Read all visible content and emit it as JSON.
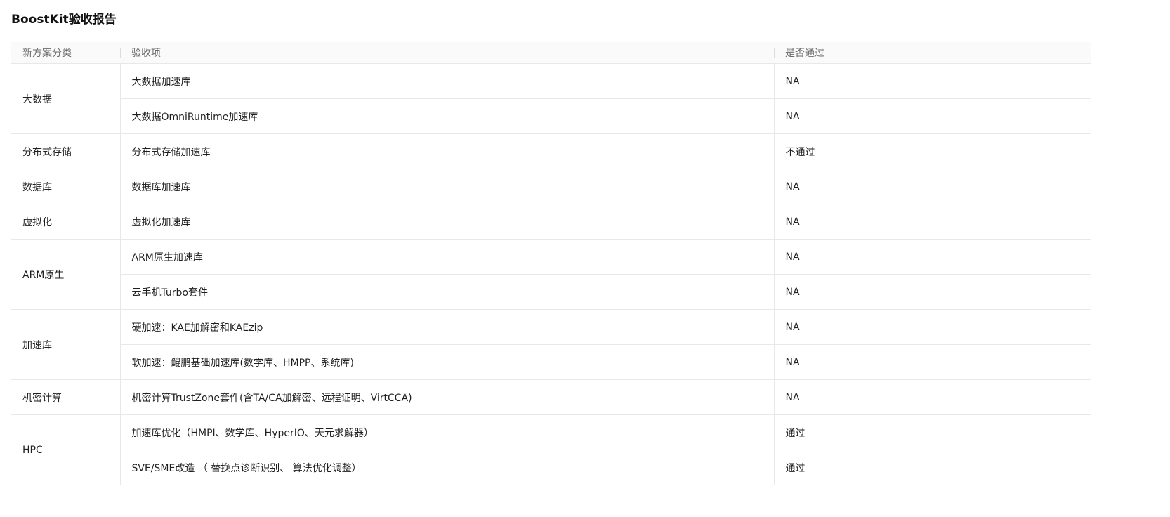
{
  "title": "BoostKit验收报告",
  "table": {
    "headers": [
      "新方案分类",
      "验收项",
      "是否通过"
    ],
    "groups": [
      {
        "category": "大数据",
        "items": [
          {
            "name": "大数据加速库",
            "result": "NA"
          },
          {
            "name": "大数据OmniRuntime加速库",
            "result": "NA"
          }
        ]
      },
      {
        "category": "分布式存储",
        "items": [
          {
            "name": "分布式存储加速库",
            "result": "不通过"
          }
        ]
      },
      {
        "category": "数据库",
        "items": [
          {
            "name": "数据库加速库",
            "result": "NA"
          }
        ]
      },
      {
        "category": "虚拟化",
        "items": [
          {
            "name": "虚拟化加速库",
            "result": "NA"
          }
        ]
      },
      {
        "category": "ARM原生",
        "items": [
          {
            "name": "ARM原生加速库",
            "result": "NA"
          },
          {
            "name": "云手机Turbo套件",
            "result": "NA"
          }
        ]
      },
      {
        "category": "加速库",
        "items": [
          {
            "name": "硬加速：KAE加解密和KAEzip",
            "result": "NA"
          },
          {
            "name": "软加速：鲲鹏基础加速库(数学库、HMPP、系统库)",
            "result": "NA"
          }
        ]
      },
      {
        "category": "机密计算",
        "items": [
          {
            "name": "机密计算TrustZone套件(含TA/CA加解密、远程证明、VirtCCA)",
            "result": "NA"
          }
        ]
      },
      {
        "category": "HPC",
        "items": [
          {
            "name": "加速库优化（HMPI、数学库、HyperIO、天元求解器）",
            "result": "通过"
          },
          {
            "name": "SVE/SME改造 （ 替换点诊断识别、 算法优化调整）",
            "result": "通过"
          }
        ]
      }
    ]
  }
}
